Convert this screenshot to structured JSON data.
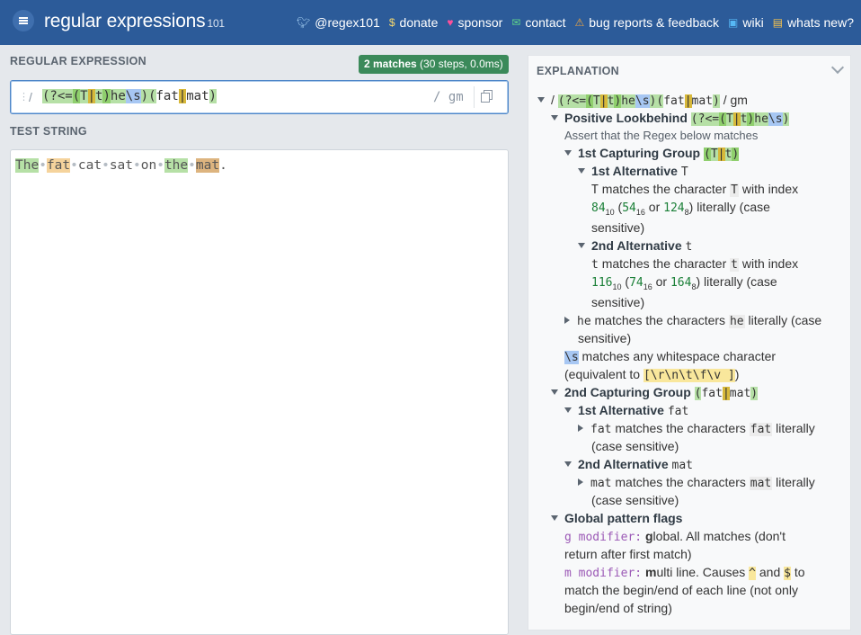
{
  "header": {
    "brand": "regular expressions",
    "version": "101",
    "links": [
      {
        "label": "@regex101",
        "icon": "twitter-icon",
        "color": "#a9d3f5"
      },
      {
        "label": "donate",
        "icon": "dollar-icon",
        "color": "#f5d76e"
      },
      {
        "label": "sponsor",
        "icon": "heart-icon",
        "color": "#ff4f9a"
      },
      {
        "label": "contact",
        "icon": "mail-icon",
        "color": "#5fd38a"
      },
      {
        "label": "bug reports & feedback",
        "icon": "warning-icon",
        "color": "#f0a640"
      },
      {
        "label": "wiki",
        "icon": "chat-icon",
        "color": "#56b8f5"
      },
      {
        "label": "whats new?",
        "icon": "gift-icon",
        "color": "#f5c24e"
      }
    ]
  },
  "regex": {
    "section_label": "REGULAR EXPRESSION",
    "match_count": "2 matches",
    "match_stats": "(30 steps, 0.0ms)",
    "open_delim": "/",
    "flags": "/ gm",
    "pattern": "(?<=(T|t)he\\s)(fat|mat)"
  },
  "test": {
    "section_label": "TEST STRING",
    "text": "The fat cat sat on the mat."
  },
  "explanation": {
    "title": "EXPLANATION",
    "root_prefix": "/",
    "root_suffix": "/ gm",
    "lookbehind_title": "Positive Lookbehind",
    "lookbehind_desc": "Assert that the Regex below matches",
    "group1_title": "1st Capturing Group",
    "alt1_title": "1st Alternative",
    "alt1_char": "T",
    "alt1_desc_a": "matches the character",
    "alt1_desc_b": "with index",
    "alt1_dec": "84",
    "alt1_hex": "54",
    "alt1_oct": "124",
    "case_sensitive": "literally (case",
    "sensitive": "sensitive)",
    "alt2_title": "2nd Alternative",
    "alt2_char": "t",
    "alt2_dec": "116",
    "alt2_hex": "74",
    "alt2_oct": "164",
    "he_token": "he",
    "he_desc": "matches the characters",
    "he_desc_b": "literally (case",
    "ws_token": "\\s",
    "ws_desc": "matches any whitespace character",
    "ws_equiv_a": "(equivalent to",
    "ws_equiv_set": "[\\r\\n\\t\\f\\v ]",
    "ws_equiv_b": ")",
    "group2_title": "2nd Capturing Group",
    "g2_alt1_title": "1st Alternative",
    "g2_alt1_tok": "fat",
    "g2_alt1_desc": "matches the characters",
    "g2_alt1_desc_b": "literally",
    "g2_case": "(case sensitive)",
    "g2_alt2_title": "2nd Alternative",
    "g2_alt2_tok": "mat",
    "flags_title": "Global pattern flags",
    "g_mod": "g modifier:",
    "g_desc_bold": "g",
    "g_desc": "lobal. All matches (don't",
    "g_desc2": "return after first match)",
    "m_mod": "m modifier:",
    "m_desc_bold": "m",
    "m_desc": "ulti line. Causes",
    "m_caret": "^",
    "m_and": "and",
    "m_dollar": "$",
    "m_to": "to",
    "m_desc2": "match the begin/end of each line (not only",
    "m_desc3": "begin/end of string)"
  }
}
